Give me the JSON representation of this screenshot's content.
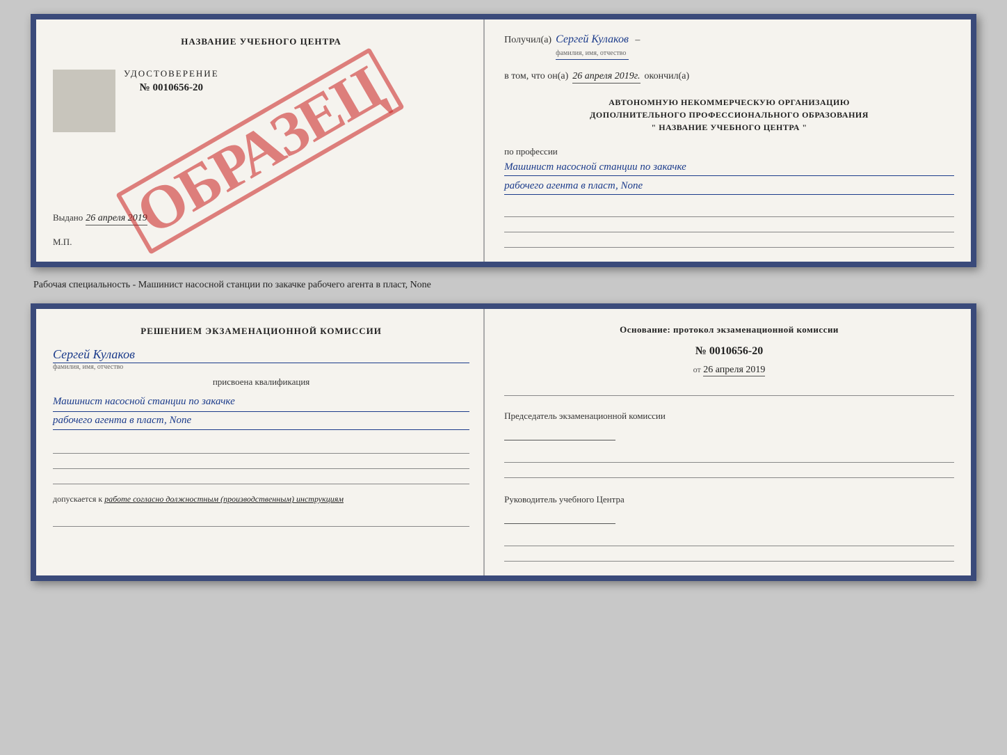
{
  "top_left": {
    "center_title": "НАЗВАНИЕ УЧЕБНОГО ЦЕНТРА",
    "cert_label": "УДОСТОВЕРЕНИЕ",
    "cert_number": "№ 0010656-20",
    "issued_label": "Выдано",
    "issued_date": "26 апреля 2019",
    "mp_label": "М.П.",
    "obrazets": "ОБРАЗЕЦ"
  },
  "top_right": {
    "poluchil_label": "Получил(а)",
    "poluchil_name": "Сергей Кулаков",
    "fio_sub": "фамилия, имя, отчество",
    "vtom_label": "в том, что он(а)",
    "vtom_date": "26 апреля 2019г.",
    "okonchil": "окончил(а)",
    "org_line1": "АВТОНОМНУЮ НЕКОММЕРЧЕСКУЮ ОРГАНИЗАЦИЮ",
    "org_line2": "ДОПОЛНИТЕЛЬНОГО ПРОФЕССИОНАЛЬНОГО ОБРАЗОВАНИЯ",
    "org_name": "\" НАЗВАНИЕ УЧЕБНОГО ЦЕНТРА \"",
    "po_professii_label": "по профессии",
    "profession_line1": "Машинист насосной станции по закачке",
    "profession_line2": "рабочего агента в пласт, None"
  },
  "middle_text": "Рабочая специальность - Машинист насосной станции по закачке рабочего агента в пласт, None",
  "bottom_left": {
    "resheniem_line1": "Решением экзаменационной комиссии",
    "person_name": "Сергей Кулаков",
    "fio_sub": "фамилия, имя, отчество",
    "prisvoena": "присвоена квалификация",
    "kvalif_line1": "Машинист насосной станции по закачке",
    "kvalif_line2": "рабочего агента в пласт, None",
    "dopusk_label": "допускается к",
    "dopusk_work": "работе согласно должностным (производственным) инструкциям"
  },
  "bottom_right": {
    "osnovanie_title": "Основание: протокол экзаменационной комиссии",
    "number_label": "№ 0010656-20",
    "ot_label": "от",
    "ot_date": "26 апреля 2019",
    "chairman_label": "Председатель экзаменационной комиссии",
    "rukovod_label": "Руководитель учебного Центра"
  }
}
